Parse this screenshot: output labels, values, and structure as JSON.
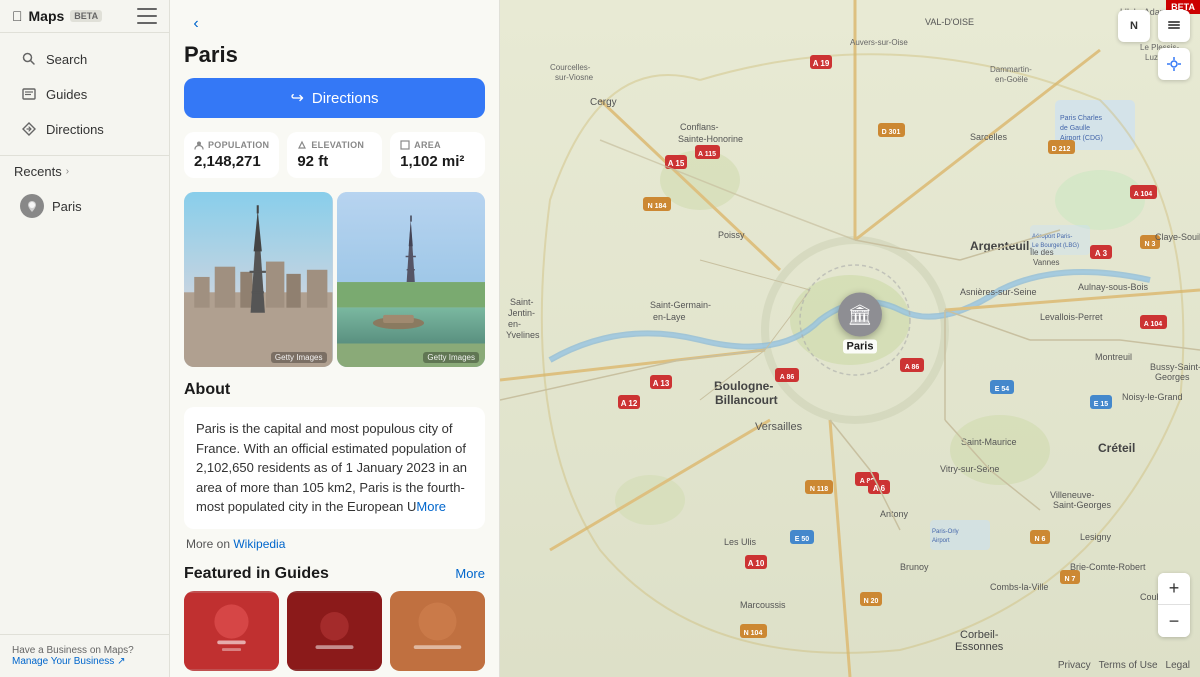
{
  "app": {
    "title": "Maps",
    "beta": "BETA"
  },
  "sidebar": {
    "search_label": "Search",
    "guides_label": "Guides",
    "directions_label": "Directions",
    "recents_label": "Recents",
    "recent_place": "Paris",
    "footer_line1": "Have a Business on Maps?",
    "footer_link": "Manage Your Business ↗"
  },
  "detail": {
    "place_title": "Paris",
    "directions_btn": "Directions",
    "back_icon": "‹",
    "stats": {
      "population_label": "POPULATION",
      "population_value": "2,148,271",
      "elevation_label": "ELEVATION",
      "elevation_value": "92 ft",
      "area_label": "AREA",
      "area_value": "1,102 mi²"
    },
    "photos": [
      {
        "credit": "Getty Images"
      },
      {
        "credit": "Getty Images"
      }
    ],
    "about_title": "About",
    "about_text": "Paris is the capital and most populous city of France. With an official estimated population of 2,102,650 residents as of 1 January 2023 in an area of more than 105 km2, Paris is the fourth-most populated city in the European U...",
    "more_label": "More",
    "wikipedia_prefix": "More on ",
    "wikipedia_link": "Wikipedia",
    "featured_title": "Featured in Guides",
    "featured_more": "More"
  },
  "map": {
    "marker_label": "Paris",
    "controls": {
      "layers_icon": "⊞",
      "location_icon": "◎",
      "north_label": "N",
      "zoom_in": "+",
      "zoom_out": "−"
    },
    "footer": {
      "privacy": "Privacy",
      "terms": "Terms of Use",
      "legal": "Legal"
    }
  }
}
